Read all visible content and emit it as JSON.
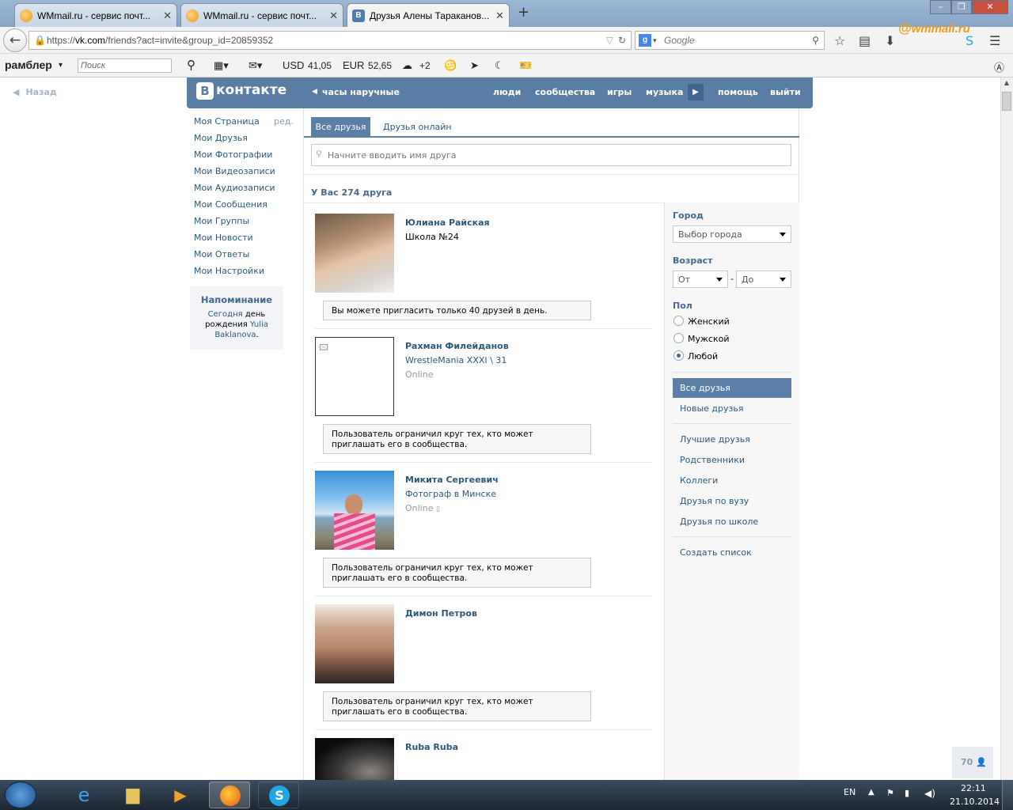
{
  "browser": {
    "tabs": [
      {
        "title": "WMmail.ru - сервис почт...",
        "icon": "wmmail-icon"
      },
      {
        "title": "WMmail.ru - сервис почт...",
        "icon": "wmmail-icon"
      },
      {
        "title": "Друзья Алены Тараканов...",
        "icon": "vk-icon"
      }
    ],
    "new_tab": "+",
    "url_prefix": "https://",
    "url_host": "vk.com",
    "url_rest": "/friends?act=invite&group_id=20859352",
    "search_engine": "Google",
    "search_placeholder": "Google",
    "wmmail_logo": "wmmail.ru"
  },
  "rambler": {
    "brand": "рамблер",
    "search_placeholder": "Поиск",
    "usd_label": "USD",
    "usd_value": "41,05",
    "eur_label": "EUR",
    "eur_value": "52,65",
    "weather": "+2"
  },
  "vk": {
    "back": "Назад",
    "logo": "контакте",
    "logo_letter": "В",
    "header_link": "часы наручные",
    "nav": [
      "люди",
      "сообщества",
      "игры",
      "музыка",
      "помощь",
      "выйти"
    ],
    "menu": [
      "Моя Страница",
      "Мои Друзья",
      "Мои Фотографии",
      "Мои Видеозаписи",
      "Мои Аудиозаписи",
      "Мои Сообщения",
      "Мои Группы",
      "Мои Новости",
      "Мои Ответы",
      "Мои Настройки"
    ],
    "menu_edit": "ред.",
    "reminder": {
      "title": "Напоминание",
      "today": "Сегодня",
      "text1": " день рождения ",
      "name": "Yulia Baklanova",
      "dot": "."
    },
    "tabs": [
      "Все друзья",
      "Друзья онлайн"
    ],
    "search_placeholder": "Начните вводить имя друга",
    "count": "У Вас 274 друга",
    "friends": [
      {
        "name": "Юлиана Райская",
        "line1": "Школа №24",
        "line2": "",
        "notice": "Вы можете пригласить только 40 друзей в день."
      },
      {
        "name": "Рахман Филейданов",
        "line1": "WrestleMania XXXI \\ 31",
        "line2": "Online",
        "notice": "Пользователь ограничил круг тех, кто может приглашать его в сообщества."
      },
      {
        "name": "Микита Сергеевич",
        "line1": "Фотограф в Минске",
        "line2": "Online",
        "notice": "Пользователь ограничил круг тех, кто может приглашать его в сообщества."
      },
      {
        "name": "Димон Петров",
        "line1": "",
        "line2": "",
        "notice": "Пользователь ограничил круг тех, кто может приглашать его в сообщества."
      },
      {
        "name": "Ruba Ruba",
        "line1": "",
        "line2": "",
        "notice": ""
      }
    ],
    "filter": {
      "city_label": "Город",
      "city_value": "Выбор города",
      "age_label": "Возраст",
      "age_from": "От",
      "age_dash": "-",
      "age_to": "До",
      "sex_label": "Пол",
      "sex": [
        "Женский",
        "Мужской",
        "Любой"
      ],
      "sex_selected": "Любой",
      "lists": [
        "Все друзья",
        "Новые друзья",
        "Лучшие друзья",
        "Родственники",
        "Коллеги",
        "Друзья по вузу",
        "Друзья по школе",
        "Создать список"
      ]
    },
    "online_counter": "70"
  },
  "taskbar": {
    "lang": "EN",
    "time": "22:11",
    "date": "21.10.2014"
  },
  "colors": {
    "vk_blue": "#597da3",
    "link": "#2b587a",
    "active": "#5b7fa6"
  }
}
